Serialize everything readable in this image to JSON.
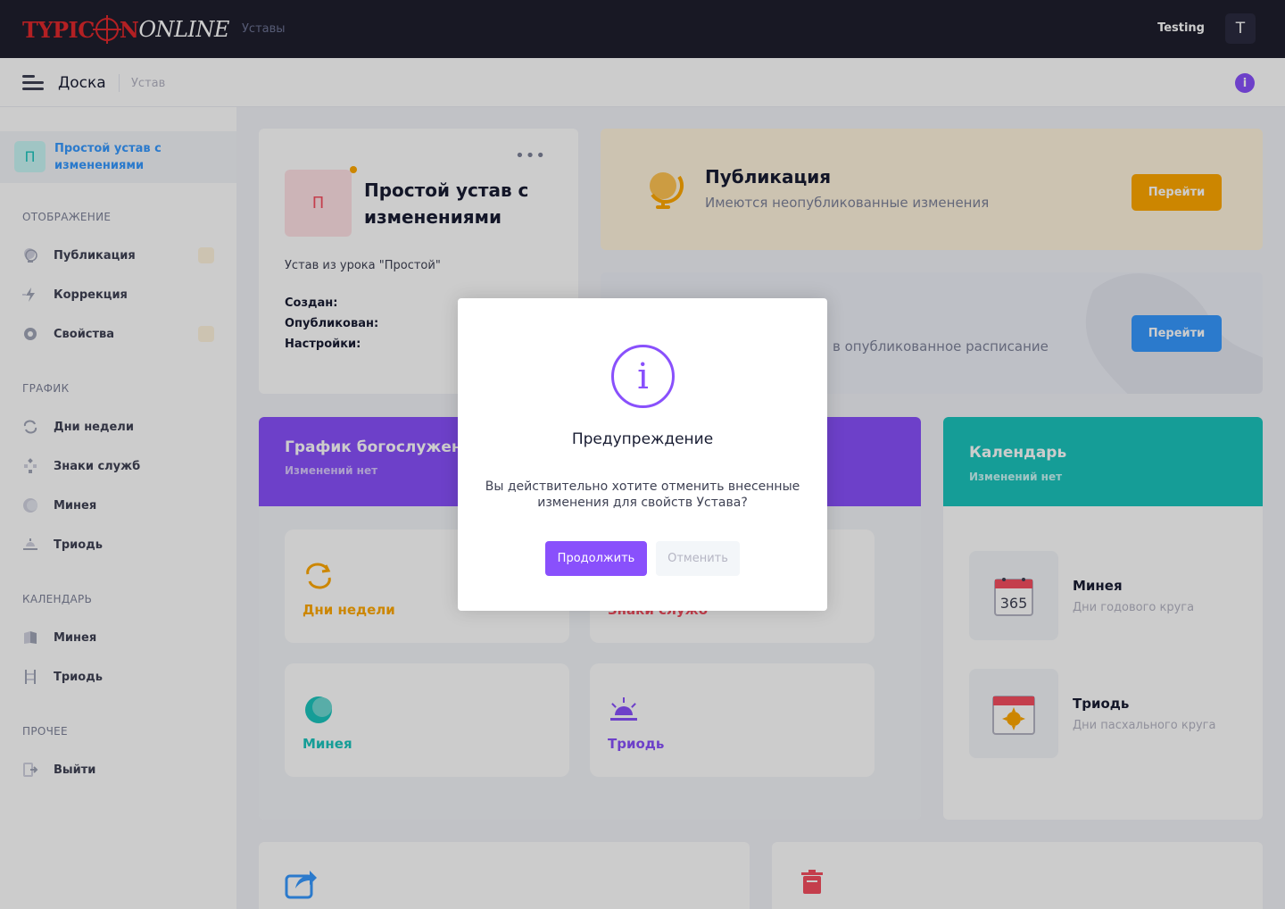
{
  "header": {
    "logo": {
      "part1": "TYPIC",
      "part2": "N",
      "part3": "ONLINE"
    },
    "nav_label": "Уставы",
    "user_name": "Testing",
    "user_initial": "T"
  },
  "subheader": {
    "title": "Доска",
    "breadcrumb": "Устав",
    "info_glyph": "i"
  },
  "sidebar": {
    "current": {
      "initial": "П",
      "label": "Простой устав с изменениями"
    },
    "sections": {
      "display": "ОТОБРАЖЕНИЕ",
      "graph": "ГРАФИК",
      "calendar": "КАЛЕНДАРЬ",
      "other": "ПРОЧЕЕ"
    },
    "items": {
      "publication": {
        "label": "Публикация",
        "icon": "globe-icon"
      },
      "correction": {
        "label": "Коррекция",
        "icon": "lightning-icon"
      },
      "properties": {
        "label": "Свойства",
        "icon": "gear-icon"
      },
      "weekdays": {
        "label": "Дни недели",
        "icon": "repeat-icon"
      },
      "service_signs": {
        "label": "Знаки служб",
        "icon": "diamond-icon"
      },
      "menaion": {
        "label": "Минея",
        "icon": "moon-icon"
      },
      "triodion": {
        "label": "Триодь",
        "icon": "sunrise-icon"
      },
      "cal_menaion": {
        "label": "Минея",
        "icon": "book-icon"
      },
      "cal_triodion": {
        "label": "Триодь",
        "icon": "ladder-icon"
      },
      "logout": {
        "label": "Выйти",
        "icon": "sign-out-icon"
      }
    }
  },
  "rule_card": {
    "initial": "П",
    "title": "Простой устав с изменениями",
    "menu_glyph": "•••",
    "description": "Устав из урока \"Простой\"",
    "created_label": "Создан:",
    "published_label": "Опубликован:",
    "settings_label": "Настройки:"
  },
  "publication_card": {
    "title": "Публикация",
    "subtitle": "Имеются неопубликованные изменения",
    "button": "Перейти"
  },
  "schedule_card": {
    "subtitle": "в опубликованное расписание",
    "button": "Перейти"
  },
  "graph_card": {
    "title": "График богослужений",
    "subtitle": "Изменений нет",
    "tiles": {
      "weekdays": "Дни недели",
      "service_signs": "Знаки служб",
      "menaion": "Минея",
      "triodion": "Триодь"
    }
  },
  "calendar_card": {
    "title": "Календарь",
    "subtitle": "Изменений нет",
    "menaion": {
      "title": "Минея",
      "subtitle": "Дни годового круга",
      "icon_text": "365"
    },
    "triodion": {
      "title": "Триодь",
      "subtitle": "Дни пасхального круга"
    }
  },
  "modal": {
    "icon_glyph": "i",
    "title": "Предупреждение",
    "text": "Вы действительно хотите отменить внесенные изменения для свойств Устава?",
    "confirm": "Продолжить",
    "cancel": "Отменить"
  },
  "colors": {
    "primary": "#8950fc",
    "warning": "#ffa800",
    "info": "#3699ff",
    "success": "#1bc5bd",
    "danger": "#f64e60",
    "dark_header": "#1e1e2d"
  }
}
